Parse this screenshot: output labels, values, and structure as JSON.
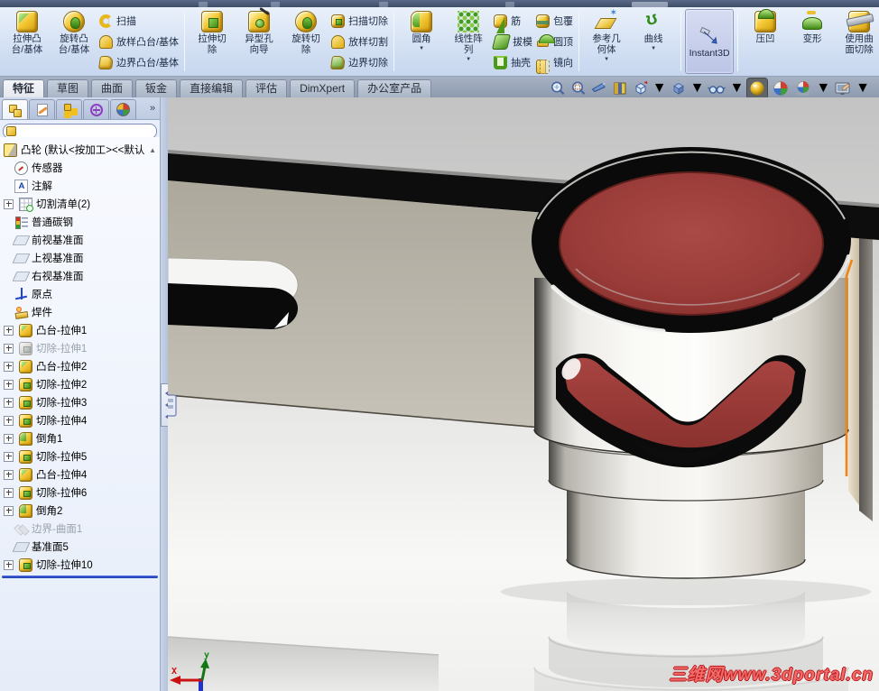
{
  "colors": {
    "selection_orange": "#ef8418",
    "rollback_blue": "#2b50d8",
    "model_red": "#9c3c39",
    "ribbon_bg": "#d3e0f3"
  },
  "ribbon": {
    "groups": [
      {
        "big": [
          "拉伸凸\n台/基体",
          "旋转凸\n台/基体"
        ],
        "small": [
          "扫描",
          "放样凸台/基体",
          "边界凸台/基体"
        ]
      },
      {
        "big": [
          "拉伸切\n除",
          "异型孔\n向导",
          "旋转切\n除"
        ],
        "small": [
          "扫描切除",
          "放样切割",
          "边界切除"
        ]
      },
      {
        "big": [
          "圆角",
          "线性阵\n列"
        ],
        "small": [
          "筋",
          "拔模",
          "抽壳",
          "包覆",
          "圆顶",
          "镜向"
        ]
      },
      {
        "big": [
          "参考几\n何体",
          "曲线"
        ]
      },
      {
        "big": [
          "Instant3D"
        ]
      },
      {
        "big": [
          "压凹",
          "变形",
          "使用曲\n面切除"
        ]
      }
    ]
  },
  "tabs": [
    "特征",
    "草图",
    "曲面",
    "钣金",
    "直接编辑",
    "评估",
    "DimXpert",
    "办公室产品"
  ],
  "headsup_icons": [
    "zoom-to-fit",
    "zoom-to-area",
    "view-previous",
    "section-view",
    "view-orientation",
    "display-style",
    "hide-show-items",
    "apply-appearance",
    "apply-scene",
    "view-settings",
    "edit-appearance"
  ],
  "panel_tabs": [
    "featuremanager-tree",
    "propertymanager",
    "configurationmanager",
    "dimxpertmanager",
    "displaymanager"
  ],
  "panel": {
    "more": "»",
    "root": "凸轮 (默认<按加工><<默认",
    "scroll_up": "▲",
    "items": [
      "传感器",
      "注解",
      "切割清单(2)",
      "普通碳钢",
      "前视基准面",
      "上视基准面",
      "右视基准面",
      "原点",
      "焊件",
      "凸台-拉伸1",
      "切除-拉伸1",
      "凸台-拉伸2",
      "切除-拉伸2",
      "切除-拉伸3",
      "切除-拉伸4",
      "倒角1",
      "切除-拉伸5",
      "凸台-拉伸4",
      "切除-拉伸6",
      "倒角2",
      "边界-曲面1",
      "基准面5",
      "切除-拉伸10"
    ]
  },
  "axes": {
    "x": "X",
    "y": "y"
  },
  "watermark": "三维网www.3dportal.cn"
}
